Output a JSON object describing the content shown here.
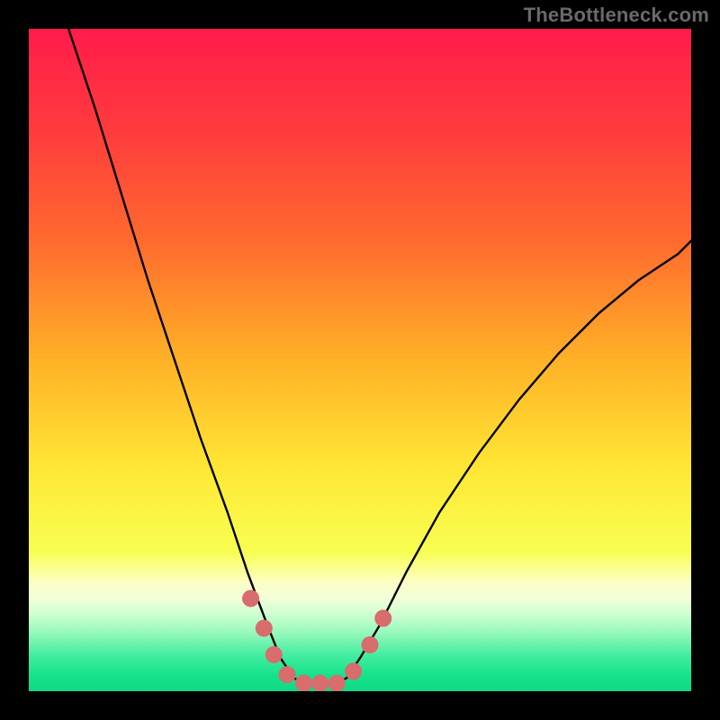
{
  "watermark": "TheBottleneck.com",
  "chart_data": {
    "type": "line",
    "title": "",
    "xlabel": "",
    "ylabel": "",
    "xlim": [
      0,
      100
    ],
    "ylim": [
      0,
      100
    ],
    "note": "Axes unlabeled; values estimated from gridless plot. x is normalized horizontal position (0–100), y is normalized vertical value (0 = bottom, 100 = top). Curve is a V-shape with minimum near x≈39–48.",
    "series": [
      {
        "name": "curve",
        "x": [
          6,
          10,
          14,
          18,
          22,
          26,
          30,
          33,
          36,
          38,
          40,
          42,
          44,
          46,
          48,
          50,
          53,
          57,
          62,
          68,
          74,
          80,
          86,
          92,
          98,
          100
        ],
        "y": [
          100,
          88,
          75,
          62,
          50,
          38,
          27,
          18,
          10,
          5,
          2,
          1,
          1,
          1,
          2,
          5,
          10,
          18,
          27,
          36,
          44,
          51,
          57,
          62,
          66,
          68
        ],
        "color": "#000000"
      }
    ],
    "markers": {
      "name": "dots",
      "color": "#d96c6c",
      "points": [
        {
          "x": 33.5,
          "y": 14
        },
        {
          "x": 35.5,
          "y": 9.5
        },
        {
          "x": 37.0,
          "y": 5.5
        },
        {
          "x": 39.0,
          "y": 2.5
        },
        {
          "x": 41.5,
          "y": 1.2
        },
        {
          "x": 44.0,
          "y": 1.2
        },
        {
          "x": 46.5,
          "y": 1.2
        },
        {
          "x": 49.0,
          "y": 3.0
        },
        {
          "x": 51.5,
          "y": 7.0
        },
        {
          "x": 53.5,
          "y": 11.0
        }
      ]
    },
    "background_gradient": {
      "direction": "vertical",
      "stops": [
        {
          "pos": 0.0,
          "color": "#ff1c4b"
        },
        {
          "pos": 0.15,
          "color": "#ff3a3d"
        },
        {
          "pos": 0.32,
          "color": "#ff6a2e"
        },
        {
          "pos": 0.5,
          "color": "#ffb127"
        },
        {
          "pos": 0.66,
          "color": "#ffe634"
        },
        {
          "pos": 0.79,
          "color": "#f8ff52"
        },
        {
          "pos": 0.835,
          "color": "#fdffc4"
        },
        {
          "pos": 0.86,
          "color": "#f2ffd8"
        },
        {
          "pos": 0.885,
          "color": "#ccffd1"
        },
        {
          "pos": 0.912,
          "color": "#96f8bc"
        },
        {
          "pos": 0.945,
          "color": "#45eda0"
        },
        {
          "pos": 0.975,
          "color": "#17e38c"
        },
        {
          "pos": 1.0,
          "color": "#0fd983"
        }
      ]
    }
  }
}
